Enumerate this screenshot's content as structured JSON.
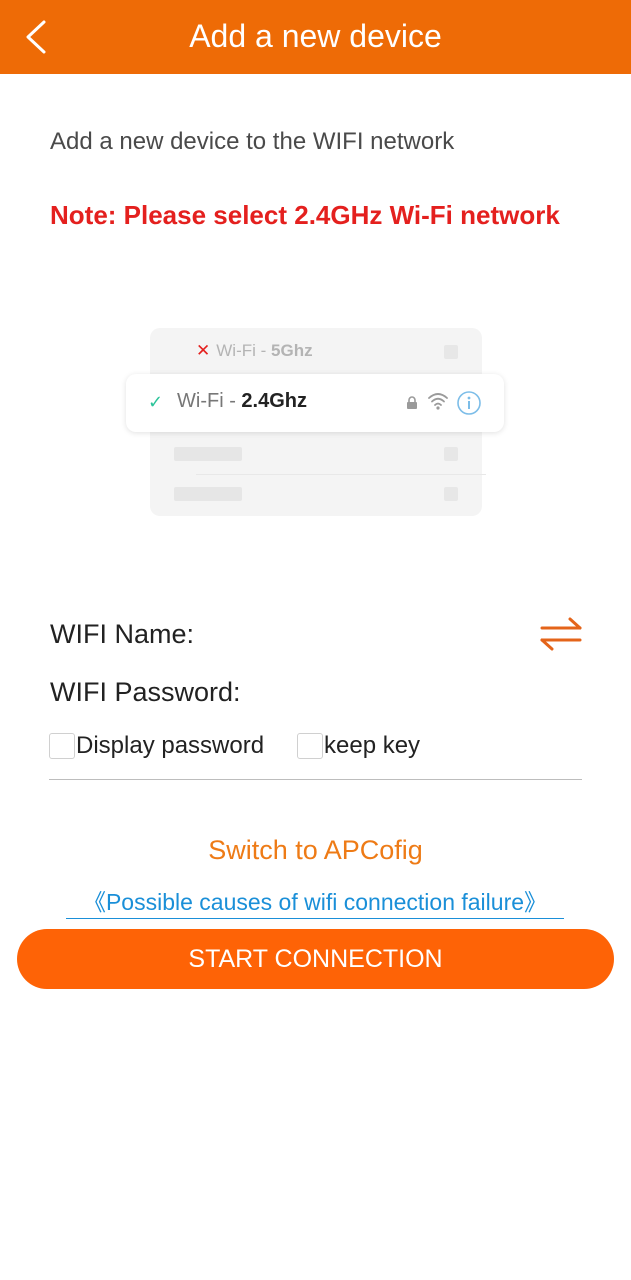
{
  "header": {
    "title": "Add a new device"
  },
  "intro_text": "Add a new device to the WIFI network",
  "note_text": "Note: Please select 2.4GHz Wi-Fi network",
  "illustration": {
    "row_5ghz": {
      "prefix": "Wi-Fi - ",
      "band": "5Ghz"
    },
    "row_24ghz": {
      "prefix": "Wi-Fi - ",
      "band": "2.4Ghz"
    }
  },
  "form": {
    "wifi_name_label": "WIFI Name:",
    "wifi_password_label": "WIFI Password:",
    "display_password_label": "Display password",
    "keep_key_label": "keep key"
  },
  "links": {
    "switch_apconfig": "Switch to APCofig",
    "possible_causes": "《Possible causes of wifi connection failure》"
  },
  "start_button": "START CONNECTION",
  "colors": {
    "header_bg": "#ee6b06",
    "note": "#e4201e",
    "accent_link": "#ee7b16",
    "help_link": "#1a8fd8",
    "start_button": "#fe6306"
  }
}
